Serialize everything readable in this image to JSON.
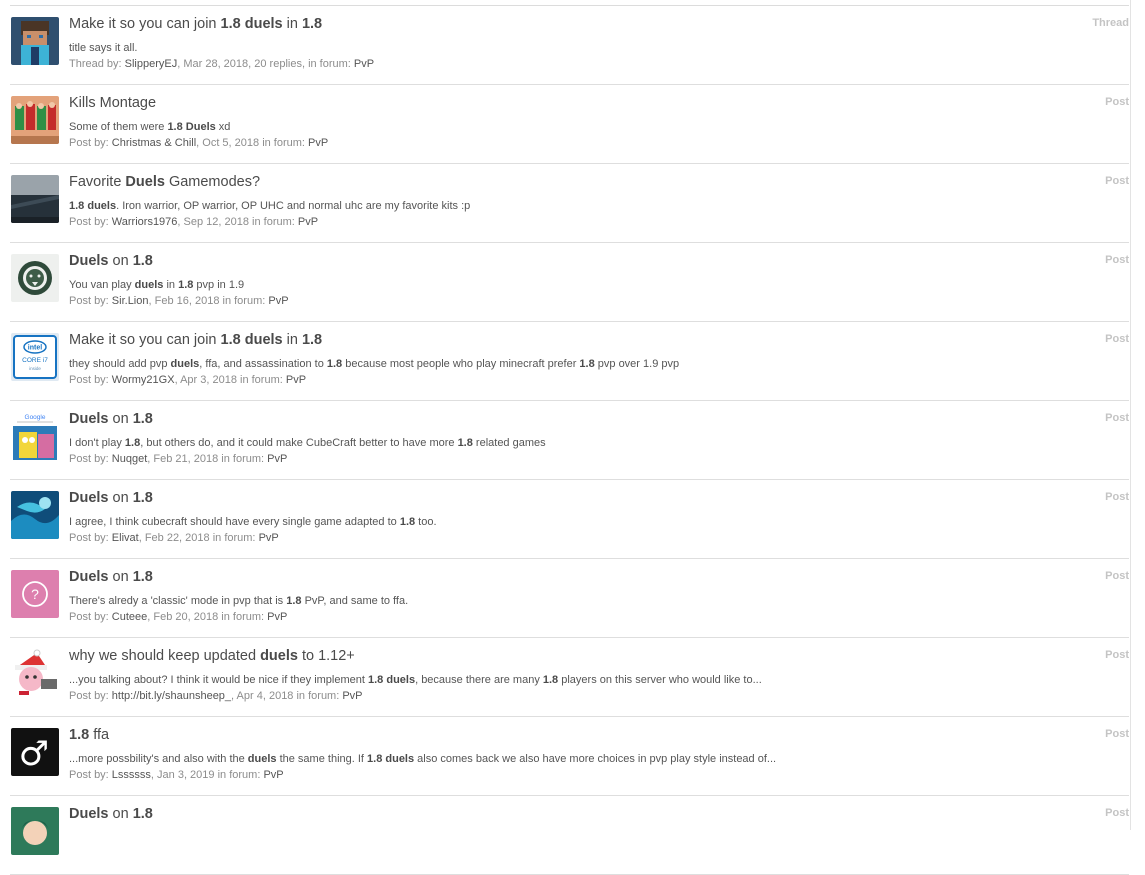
{
  "results": [
    {
      "title_parts": [
        {
          "t": "Make it so you can join ",
          "b": false
        },
        {
          "t": "1.8",
          "b": true
        },
        {
          "t": " ",
          "b": false
        },
        {
          "t": "duels",
          "b": true
        },
        {
          "t": " in ",
          "b": false
        },
        {
          "t": "1.8",
          "b": true
        }
      ],
      "snippet_parts": [
        {
          "t": "title says it all.",
          "b": false
        }
      ],
      "meta_prefix": "Thread by: ",
      "user": "SlipperyEJ",
      "meta_middle": ", Mar 28, 2018, 20 replies, in forum: ",
      "forum": "PvP",
      "type": "Thread",
      "avatar": "minecraft-skin-avatar"
    },
    {
      "title_parts": [
        {
          "t": "Kills Montage",
          "b": false
        }
      ],
      "snippet_parts": [
        {
          "t": "Some of them were ",
          "b": false
        },
        {
          "t": "1.8 Duels",
          "b": true
        },
        {
          "t": " xd",
          "b": false
        }
      ],
      "meta_prefix": "Post by: ",
      "user": "Christmas & Chill",
      "meta_middle": ", Oct 5, 2018 in forum: ",
      "forum": "PvP",
      "type": "Post",
      "avatar": "christmas-group-avatar"
    },
    {
      "title_parts": [
        {
          "t": "Favorite ",
          "b": false
        },
        {
          "t": "Duels",
          "b": true
        },
        {
          "t": " Gamemodes?",
          "b": false
        }
      ],
      "snippet_parts": [
        {
          "t": "1.8 duels",
          "b": true
        },
        {
          "t": ". Iron warrior, OP warrior, OP UHC and normal uhc are my favorite kits :p",
          "b": false
        }
      ],
      "meta_prefix": "Post by: ",
      "user": "Warriors1976",
      "meta_middle": ", Sep 12, 2018 in forum: ",
      "forum": "PvP",
      "type": "Post",
      "avatar": "sea-landscape-avatar"
    },
    {
      "title_parts": [
        {
          "t": "Duels",
          "b": true
        },
        {
          "t": " on ",
          "b": false
        },
        {
          "t": "1.8",
          "b": true
        }
      ],
      "snippet_parts": [
        {
          "t": "You van play ",
          "b": false
        },
        {
          "t": "duels",
          "b": true
        },
        {
          "t": " in ",
          "b": false
        },
        {
          "t": "1.8",
          "b": true
        },
        {
          "t": " pvp in 1.9",
          "b": false
        }
      ],
      "meta_prefix": "Post by: ",
      "user": "Sir.Lion",
      "meta_middle": ", Feb 16, 2018 in forum: ",
      "forum": "PvP",
      "type": "Post",
      "avatar": "lion-emblem-avatar"
    },
    {
      "title_parts": [
        {
          "t": "Make it so you can join ",
          "b": false
        },
        {
          "t": "1.8",
          "b": true
        },
        {
          "t": " ",
          "b": false
        },
        {
          "t": "duels",
          "b": true
        },
        {
          "t": " in ",
          "b": false
        },
        {
          "t": "1.8",
          "b": true
        }
      ],
      "snippet_parts": [
        {
          "t": "they should add pvp ",
          "b": false
        },
        {
          "t": "duels",
          "b": true
        },
        {
          "t": ", ffa, and assassination to ",
          "b": false
        },
        {
          "t": "1.8",
          "b": true
        },
        {
          "t": " because most people who play minecraft prefer ",
          "b": false
        },
        {
          "t": "1.8",
          "b": true
        },
        {
          "t": " pvp over 1.9 pvp",
          "b": false
        }
      ],
      "meta_prefix": "Post by: ",
      "user": "Wormy21GX",
      "meta_middle": ", Apr 3, 2018 in forum: ",
      "forum": "PvP",
      "type": "Post",
      "avatar": "intel-core-i7-avatar",
      "avatar_text": [
        "intel",
        "CORE i7",
        "inside"
      ]
    },
    {
      "title_parts": [
        {
          "t": "Duels",
          "b": true
        },
        {
          "t": " on ",
          "b": false
        },
        {
          "t": "1.8",
          "b": true
        }
      ],
      "snippet_parts": [
        {
          "t": "I don't play ",
          "b": false
        },
        {
          "t": "1.8",
          "b": true
        },
        {
          "t": ", but others do, and it could make CubeCraft better to have more ",
          "b": false
        },
        {
          "t": "1.8",
          "b": true
        },
        {
          "t": " related games",
          "b": false
        }
      ],
      "meta_prefix": "Post by: ",
      "user": "Nuqget",
      "meta_middle": ", Feb 21, 2018 in forum: ",
      "forum": "PvP",
      "type": "Post",
      "avatar": "google-spongebob-avatar",
      "avatar_text": [
        "Google"
      ]
    },
    {
      "title_parts": [
        {
          "t": "Duels",
          "b": true
        },
        {
          "t": " on ",
          "b": false
        },
        {
          "t": "1.8",
          "b": true
        }
      ],
      "snippet_parts": [
        {
          "t": "I agree, I think cubecraft should have every single game adapted to ",
          "b": false
        },
        {
          "t": "1.8",
          "b": true
        },
        {
          "t": " too.",
          "b": false
        }
      ],
      "meta_prefix": "Post by: ",
      "user": "Elivat",
      "meta_middle": ", Feb 22, 2018 in forum: ",
      "forum": "PvP",
      "type": "Post",
      "avatar": "ocean-art-avatar"
    },
    {
      "title_parts": [
        {
          "t": "Duels",
          "b": true
        },
        {
          "t": " on ",
          "b": false
        },
        {
          "t": "1.8",
          "b": true
        }
      ],
      "snippet_parts": [
        {
          "t": "There's alredy a 'classic' mode in pvp that is ",
          "b": false
        },
        {
          "t": "1.8",
          "b": true
        },
        {
          "t": " PvP, and same to ffa.",
          "b": false
        }
      ],
      "meta_prefix": "Post by: ",
      "user": "Cuteee",
      "meta_middle": ", Feb 20, 2018 in forum: ",
      "forum": "PvP",
      "type": "Post",
      "avatar": "question-mark-avatar",
      "avatar_text": [
        "?"
      ]
    },
    {
      "title_parts": [
        {
          "t": "why we should keep updated ",
          "b": false
        },
        {
          "t": "duels",
          "b": true
        },
        {
          "t": " to 1.12+",
          "b": false
        }
      ],
      "snippet_parts": [
        {
          "t": "...you talking about? I think it would be nice if they implement ",
          "b": false
        },
        {
          "t": "1.8 duels",
          "b": true
        },
        {
          "t": ", because there are many ",
          "b": false
        },
        {
          "t": "1.8",
          "b": true
        },
        {
          "t": " players on this server who would like to...",
          "b": false
        }
      ],
      "meta_prefix": "Post by: ",
      "user": "http://bit.ly/shaunsheep_",
      "meta_middle": ", Apr 4, 2018 in forum: ",
      "forum": "PvP",
      "type": "Post",
      "avatar": "santa-kirby-avatar"
    },
    {
      "title_parts": [
        {
          "t": "1.8",
          "b": true
        },
        {
          "t": " ffa",
          "b": false
        }
      ],
      "snippet_parts": [
        {
          "t": "...more possbility's and also with the ",
          "b": false
        },
        {
          "t": "duels",
          "b": true
        },
        {
          "t": " the same thing. If ",
          "b": false
        },
        {
          "t": "1.8 duels",
          "b": true
        },
        {
          "t": " also comes back we also have more choices in pvp play style instead of...",
          "b": false
        }
      ],
      "meta_prefix": "Post by: ",
      "user": "Lssssss",
      "meta_middle": ", Jan 3, 2019 in forum: ",
      "forum": "PvP",
      "type": "Post",
      "avatar": "male-symbol-avatar",
      "avatar_text": [
        "♂"
      ]
    },
    {
      "title_parts": [
        {
          "t": "Duels",
          "b": true
        },
        {
          "t": " on ",
          "b": false
        },
        {
          "t": "1.8",
          "b": true
        }
      ],
      "snippet_parts": [],
      "meta_prefix": "",
      "user": "",
      "meta_middle": "",
      "forum": "",
      "type": "Post",
      "avatar": "anime-character-avatar"
    }
  ]
}
